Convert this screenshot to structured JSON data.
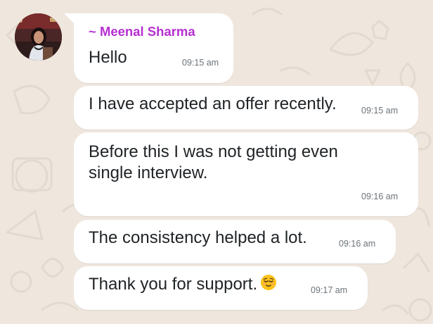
{
  "chat": {
    "sender_name": "~ Meenal Sharma",
    "sender_color": "#b62fd1",
    "bubble_color": "#ffffff",
    "background_color": "#efe7de",
    "messages": [
      {
        "text": "Hello",
        "time": "09:15 am"
      },
      {
        "text": "I have accepted an offer recently.",
        "time": "09:15 am"
      },
      {
        "line1": "Before this I was not getting even",
        "line2": "single interview.",
        "time": "09:16 am"
      },
      {
        "text": "The consistency helped a lot.",
        "time": "09:16 am"
      },
      {
        "text": "Thank you for support.",
        "emoji": "relieved-face-emoji",
        "time": "09:17 am"
      }
    ]
  }
}
